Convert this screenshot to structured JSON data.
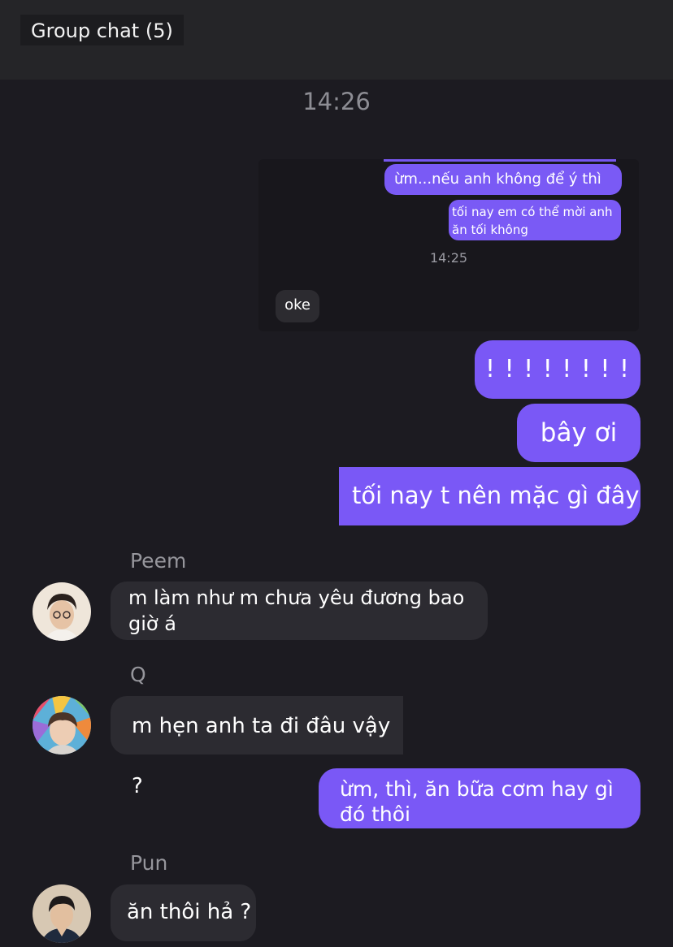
{
  "header": {
    "title": "Group chat (5)"
  },
  "timestamp": "14:26",
  "embedded_screenshot": {
    "messages": [
      "ừm...nếu anh không để ý thì",
      "tối nay em có thể mời anh ăn tối không"
    ],
    "time": "14:25",
    "reply": "oke"
  },
  "messages": [
    {
      "text": "! ! ! ! ! ! ! !"
    },
    {
      "text": "bây ơi"
    },
    {
      "text": "tối nay t nên mặc gì đây"
    },
    {
      "sender": "Peem",
      "text": "m làm như m chưa yêu đương bao giờ á"
    },
    {
      "sender": "Q",
      "text": "m hẹn anh ta đi đâu vậy ?"
    },
    {
      "text": "ừm, thì, ăn bữa cơm hay gì đó thôi"
    },
    {
      "sender": "Pun",
      "text": "ăn thôi hả ?"
    }
  ],
  "colors": {
    "background": "#1c1b21",
    "header": "#252528",
    "my_bubble": "#7a58f6",
    "their_bubble": "#2c2b31",
    "sender_name": "#96969c"
  }
}
